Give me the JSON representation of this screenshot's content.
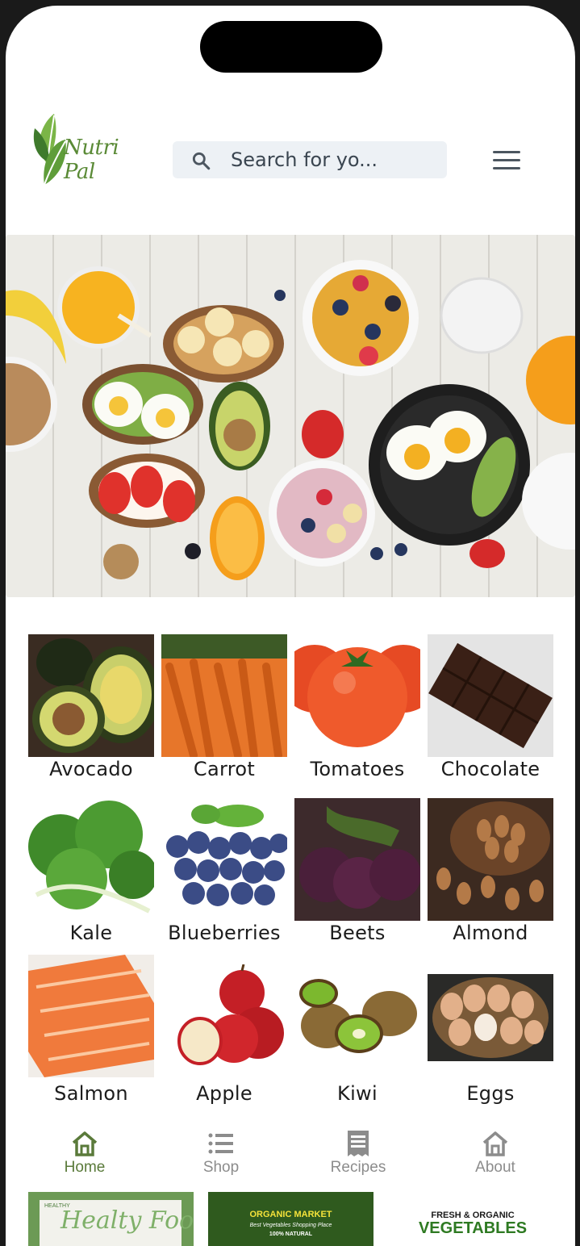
{
  "app": {
    "logo_text": "Nutri Pal"
  },
  "search": {
    "placeholder": "Search for yo..."
  },
  "foods": [
    {
      "name": "Avocado",
      "icon": "avocado-image"
    },
    {
      "name": "Carrot",
      "icon": "carrot-image"
    },
    {
      "name": "Tomatoes",
      "icon": "tomatoes-image"
    },
    {
      "name": "Chocolate",
      "icon": "chocolate-image"
    },
    {
      "name": "Kale",
      "icon": "kale-image"
    },
    {
      "name": "Blueberries",
      "icon": "blueberries-image"
    },
    {
      "name": "Beets",
      "icon": "beets-image"
    },
    {
      "name": "Almond",
      "icon": "almond-image"
    },
    {
      "name": "Salmon",
      "icon": "salmon-image"
    },
    {
      "name": "Apple",
      "icon": "apple-image"
    },
    {
      "name": "Kiwi",
      "icon": "kiwi-image"
    },
    {
      "name": "Eggs",
      "icon": "eggs-image"
    }
  ],
  "nav": {
    "items": [
      {
        "label": "Home",
        "icon": "home-icon",
        "active": true
      },
      {
        "label": "Shop",
        "icon": "list-icon",
        "active": false
      },
      {
        "label": "Recipes",
        "icon": "receipt-icon",
        "active": false
      },
      {
        "label": "About",
        "icon": "home-outline-icon",
        "active": false
      }
    ]
  },
  "promos": [
    {
      "title": "Healty Food",
      "badge": "HEALTHY"
    },
    {
      "title": "ORGANIC MARKET",
      "subtitle": "Best Vegetables Shopping Place",
      "tag": "100% NATURAL"
    },
    {
      "title": "FRESH & ORGANIC",
      "subtitle": "VEGETABLES"
    }
  ],
  "colors": {
    "accent": "#5a7a3a",
    "search_bg": "#edf1f5",
    "nav_inactive": "#8c8c8c"
  }
}
